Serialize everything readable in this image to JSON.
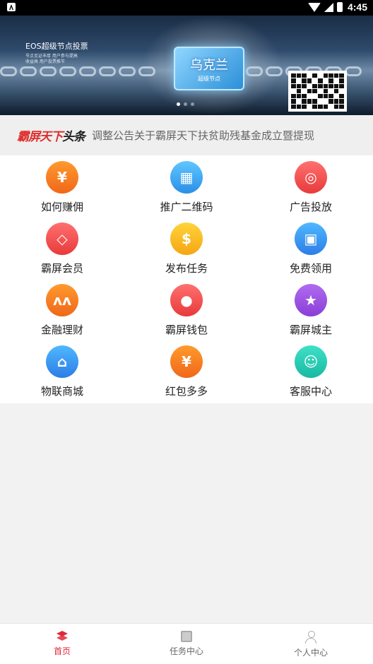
{
  "status_bar": {
    "time": "4:45"
  },
  "banner": {
    "title": "EOS超级节点投票",
    "sub_line_1": "节点见证丰厚 用户参与提高",
    "sub_line_2": "收益高 用户投票推节",
    "card_title": "乌克兰",
    "card_sub": "超级节点",
    "page_indicator": {
      "count": 3,
      "active": 0
    }
  },
  "headline": {
    "logo_red": "霸屏天下",
    "logo_black": "头条",
    "text": "调整公告关于霸屏天下扶贫助残基金成立暨提现"
  },
  "grid": {
    "items": [
      {
        "label": "如何赚佣",
        "icon": "yen-hand-icon",
        "color": "orange",
        "glyph": "¥"
      },
      {
        "label": "推广二维码",
        "icon": "qr-code-icon",
        "color": "blue",
        "glyph": "▦"
      },
      {
        "label": "广告投放",
        "icon": "target-icon",
        "color": "red",
        "glyph": "◎"
      },
      {
        "label": "霸屏会员",
        "icon": "diamond-icon",
        "color": "red",
        "glyph": "◇"
      },
      {
        "label": "发布任务",
        "icon": "coins-icon",
        "color": "yellow",
        "glyph": "$"
      },
      {
        "label": "免费领用",
        "icon": "gift-icon",
        "color": "skyblue",
        "glyph": "▣"
      },
      {
        "label": "金融理财",
        "icon": "finance-icon",
        "color": "orange",
        "glyph": "ʌʌ"
      },
      {
        "label": "霸屏钱包",
        "icon": "piggy-bank-icon",
        "color": "red",
        "glyph": "●"
      },
      {
        "label": "霸屏城主",
        "icon": "star-icon",
        "color": "purple",
        "glyph": "★"
      },
      {
        "label": "物联商城",
        "icon": "store-icon",
        "color": "skyblue",
        "glyph": "⌂"
      },
      {
        "label": "红包多多",
        "icon": "red-packet-icon",
        "color": "orange",
        "glyph": "¥"
      },
      {
        "label": "客服中心",
        "icon": "headset-icon",
        "color": "teal",
        "glyph": "☺"
      }
    ]
  },
  "tabbar": {
    "home": "首页",
    "tasks": "任务中心",
    "profile": "个人中心"
  },
  "colors": {
    "accent": "#e0283a",
    "headline_red": "#e02d2d"
  }
}
